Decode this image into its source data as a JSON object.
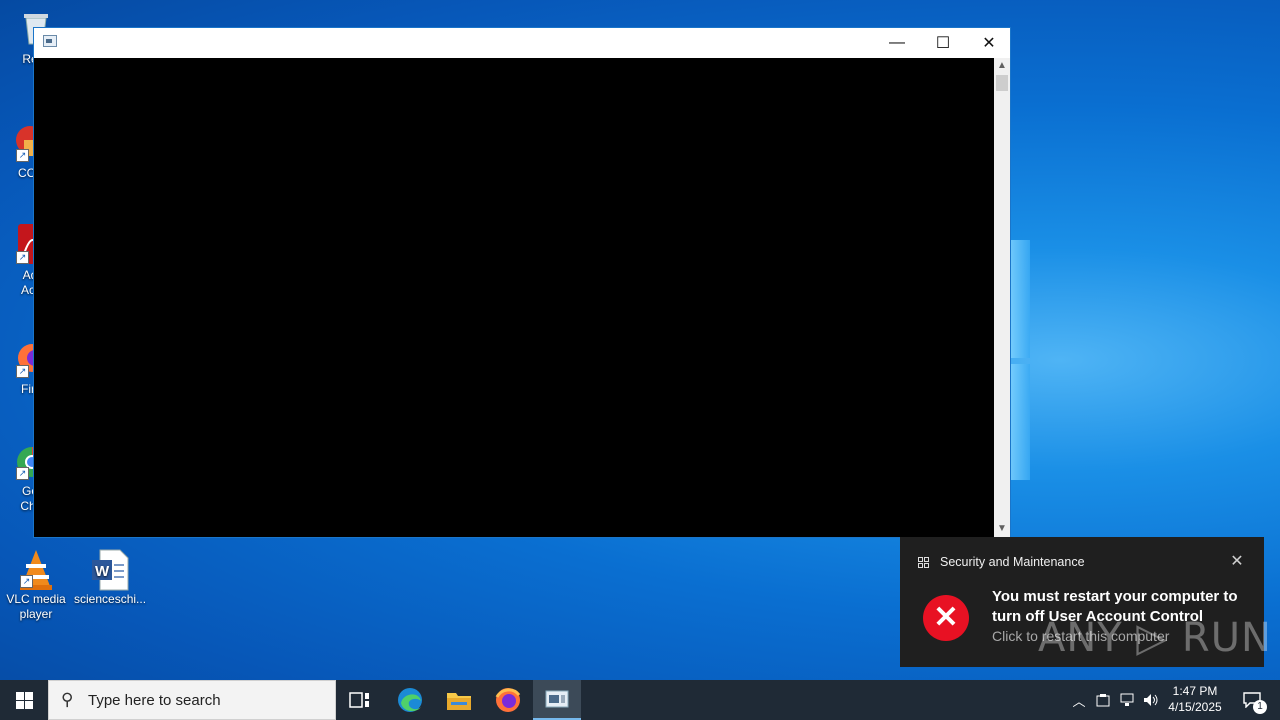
{
  "colors": {
    "desktop_accent": "#0a6fd1",
    "taskbar": "#1f2a36",
    "toast_bg": "#1f1f1f",
    "error_red": "#e81123",
    "console_bg": "#000000"
  },
  "desktop": {
    "icons": [
      {
        "label": "Recy",
        "icon": "recycle-bin-icon"
      },
      {
        "label": "CCl",
        "icon": "ccleaner-icon"
      },
      {
        "label": "Ad\nAcr",
        "icon": "adobe-acrobat-icon"
      },
      {
        "label": "Fir",
        "icon": "firefox-icon"
      },
      {
        "label": "Go\nChr",
        "icon": "chrome-icon"
      },
      {
        "label": "VLC media player",
        "icon": "vlc-icon"
      },
      {
        "label": "scienceschi...",
        "icon": "word-document-icon"
      }
    ]
  },
  "window": {
    "title": "",
    "controls": {
      "minimize": "—",
      "maximize": "☐",
      "close": "✕"
    }
  },
  "toast": {
    "source": "Security and Maintenance",
    "headline": "You must restart your computer to turn off User Account Control",
    "subtext": "Click to restart this computer",
    "close": "✕",
    "watermark": "ANY ▷ RUN"
  },
  "taskbar": {
    "search_placeholder": "Type here to search",
    "pinned": [
      "task-view-icon",
      "edge-icon",
      "file-explorer-icon",
      "firefox-icon",
      "console-app-icon"
    ],
    "clock_time": "1:47 PM",
    "clock_date": "4/15/2025",
    "notification_count": "1"
  }
}
